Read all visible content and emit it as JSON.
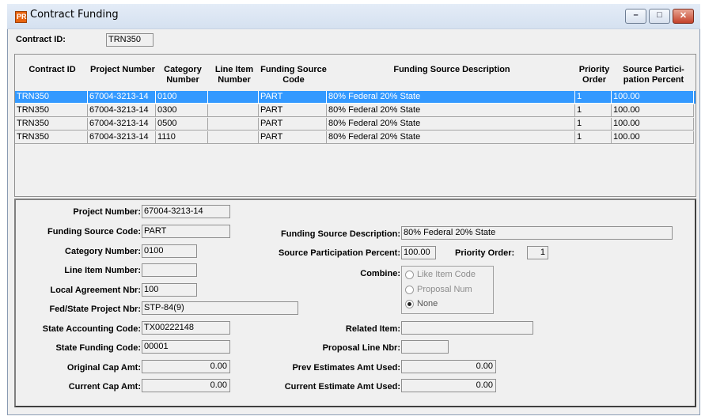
{
  "window": {
    "title": "Contract Funding",
    "icon_text": "PR"
  },
  "header": {
    "contract_id_label": "Contract ID:",
    "contract_id_value": "TRN350"
  },
  "grid": {
    "columns": [
      "Contract ID",
      "Project Number",
      "Category Number",
      "Line Item Number",
      "Funding Source Code",
      "Funding Source Description",
      "Priority Order",
      "Source Partici- pation Percent"
    ],
    "rows": [
      {
        "contract_id": "TRN350",
        "project_number": "67004-3213-14",
        "category": "0100",
        "line_item": "",
        "source_code": "PART",
        "description": "80% Federal 20% State",
        "priority": "1",
        "percent": "100.00",
        "selected": true
      },
      {
        "contract_id": "TRN350",
        "project_number": "67004-3213-14",
        "category": "0300",
        "line_item": "",
        "source_code": "PART",
        "description": "80% Federal 20% State",
        "priority": "1",
        "percent": "100.00",
        "selected": false
      },
      {
        "contract_id": "TRN350",
        "project_number": "67004-3213-14",
        "category": "0500",
        "line_item": "",
        "source_code": "PART",
        "description": "80% Federal 20% State",
        "priority": "1",
        "percent": "100.00",
        "selected": false
      },
      {
        "contract_id": "TRN350",
        "project_number": "67004-3213-14",
        "category": "1110",
        "line_item": "",
        "source_code": "PART",
        "description": "80% Federal 20% State",
        "priority": "1",
        "percent": "100.00",
        "selected": false
      }
    ]
  },
  "detail": {
    "project_number": {
      "label": "Project Number:",
      "value": "67004-3213-14"
    },
    "funding_source_code": {
      "label": "Funding Source Code:",
      "value": "PART"
    },
    "category_number": {
      "label": "Category Number:",
      "value": "0100"
    },
    "line_item_number": {
      "label": "Line Item Number:",
      "value": ""
    },
    "local_agreement_nbr": {
      "label": "Local Agreement Nbr:",
      "value": "100"
    },
    "fed_state_project_nbr": {
      "label": "Fed/State Project Nbr:",
      "value": "STP-84(9)"
    },
    "state_accounting_code": {
      "label": "State Accounting Code:",
      "value": "TX00222148"
    },
    "state_funding_code": {
      "label": "State Funding Code:",
      "value": "00001"
    },
    "original_cap_amt": {
      "label": "Original Cap Amt:",
      "value": "0.00"
    },
    "current_cap_amt": {
      "label": "Current Cap Amt:",
      "value": "0.00"
    },
    "funding_source_description": {
      "label": "Funding Source Description:",
      "value": "80% Federal 20% State"
    },
    "source_participation_percent": {
      "label": "Source Participation Percent:",
      "value": "100.00"
    },
    "priority_order": {
      "label": "Priority Order:",
      "value": "1"
    },
    "combine": {
      "label": "Combine:",
      "options": [
        "Like Item Code",
        "Proposal Num",
        "None"
      ],
      "selected": "None"
    },
    "related_item": {
      "label": "Related Item:",
      "value": ""
    },
    "proposal_line_nbr": {
      "label": "Proposal Line Nbr:",
      "value": ""
    },
    "prev_estimates_amt_used": {
      "label": "Prev Estimates Amt Used:",
      "value": "0.00"
    },
    "current_estimate_amt_used": {
      "label": "Current Estimate Amt Used:",
      "value": "0.00"
    }
  },
  "colors": {
    "selection": "#3399ff",
    "window_background": "#f0f0f0",
    "close_button": "#c4412a"
  }
}
